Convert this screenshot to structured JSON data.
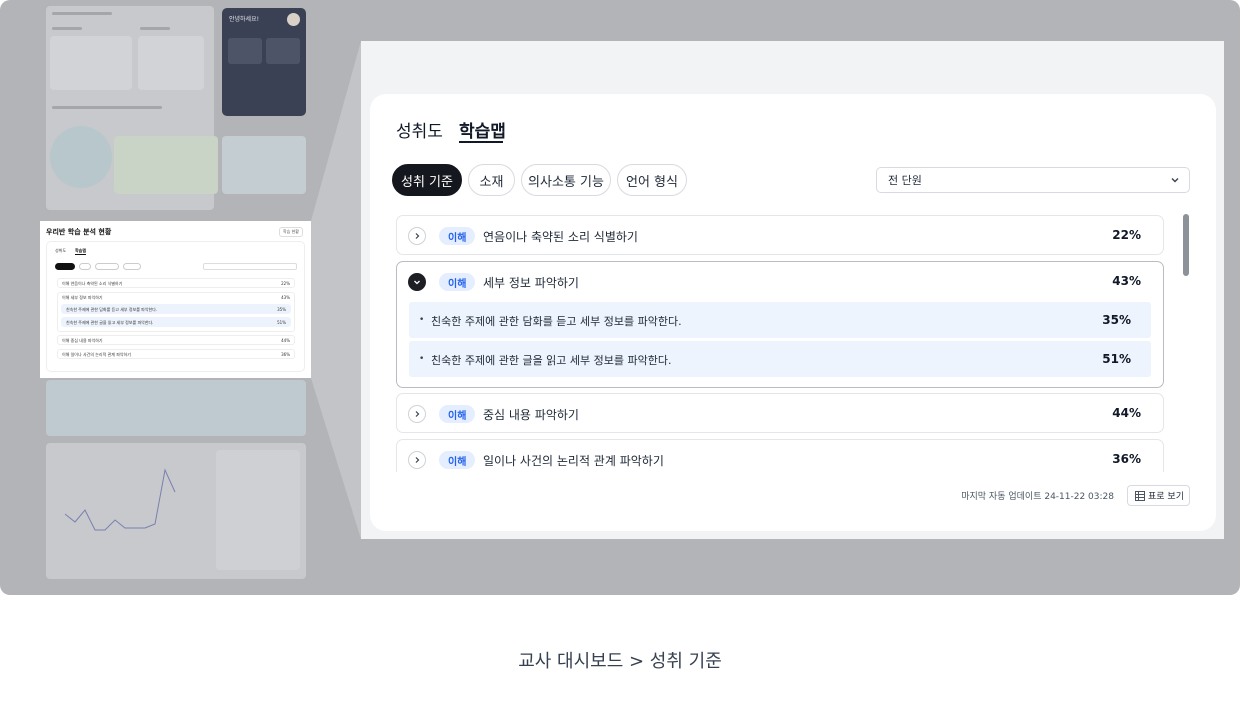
{
  "caption": "교사 대시보드 > 성취 기준",
  "background": {
    "mini_title": "우리반 학습 분석 현황",
    "mini_button": "학습 현황",
    "greeting": "안녕하세요!",
    "mini_tabs": [
      "성취도",
      "학습맵"
    ],
    "mini_rows": [
      {
        "label": "이해  연음이나 축약된 소리 식별하기",
        "pct": "22%"
      },
      {
        "label": "이해  세부 정보 파악하기",
        "pct": "43%"
      },
      {
        "label": "친숙한 주제에 관한 담화를 듣고 세부 정보를 파악한다.",
        "pct": "35%"
      },
      {
        "label": "친숙한 주제에 관한 글을 읽고 세부 정보를 파악한다.",
        "pct": "51%"
      },
      {
        "label": "이해  중심 내용 파악하기",
        "pct": "44%"
      },
      {
        "label": "이해  일이나 사건의 논리적 관계 파악하기",
        "pct": "36%"
      }
    ]
  },
  "tabs": [
    {
      "label": "성취도",
      "active": false
    },
    {
      "label": "학습맵",
      "active": true
    }
  ],
  "filters": [
    {
      "label": "성취 기준",
      "active": true
    },
    {
      "label": "소재",
      "active": false
    },
    {
      "label": "의사소통 기능",
      "active": false
    },
    {
      "label": "언어 형식",
      "active": false
    }
  ],
  "unit_select": {
    "value": "전 단원",
    "icon": "chevron-down-icon"
  },
  "items": [
    {
      "badge": "이해",
      "label": "연음이나 축약된 소리 식별하기",
      "pct": "22%",
      "expanded": false,
      "subitems": []
    },
    {
      "badge": "이해",
      "label": "세부 정보 파악하기",
      "pct": "43%",
      "expanded": true,
      "subitems": [
        {
          "label": "친숙한 주제에 관한 담화를 듣고 세부 정보를 파악한다.",
          "pct": "35%"
        },
        {
          "label": "친숙한 주제에 관한 글을 읽고 세부 정보를 파악한다.",
          "pct": "51%"
        }
      ]
    },
    {
      "badge": "이해",
      "label": "중심 내용 파악하기",
      "pct": "44%",
      "expanded": false,
      "subitems": []
    },
    {
      "badge": "이해",
      "label": "일이나 사건의 논리적 관계 파악하기",
      "pct": "36%",
      "expanded": false,
      "subitems": []
    }
  ],
  "footer": {
    "last_update": "마지막 자동 업데이트 24-11-22 03:28",
    "table_view": "표로 보기",
    "table_icon": "table-icon"
  },
  "colors": {
    "badge_bg": "#e4eeff",
    "badge_text": "#2563eb",
    "subrow_bg": "#edf4fd",
    "active_chip": "#14171d"
  }
}
